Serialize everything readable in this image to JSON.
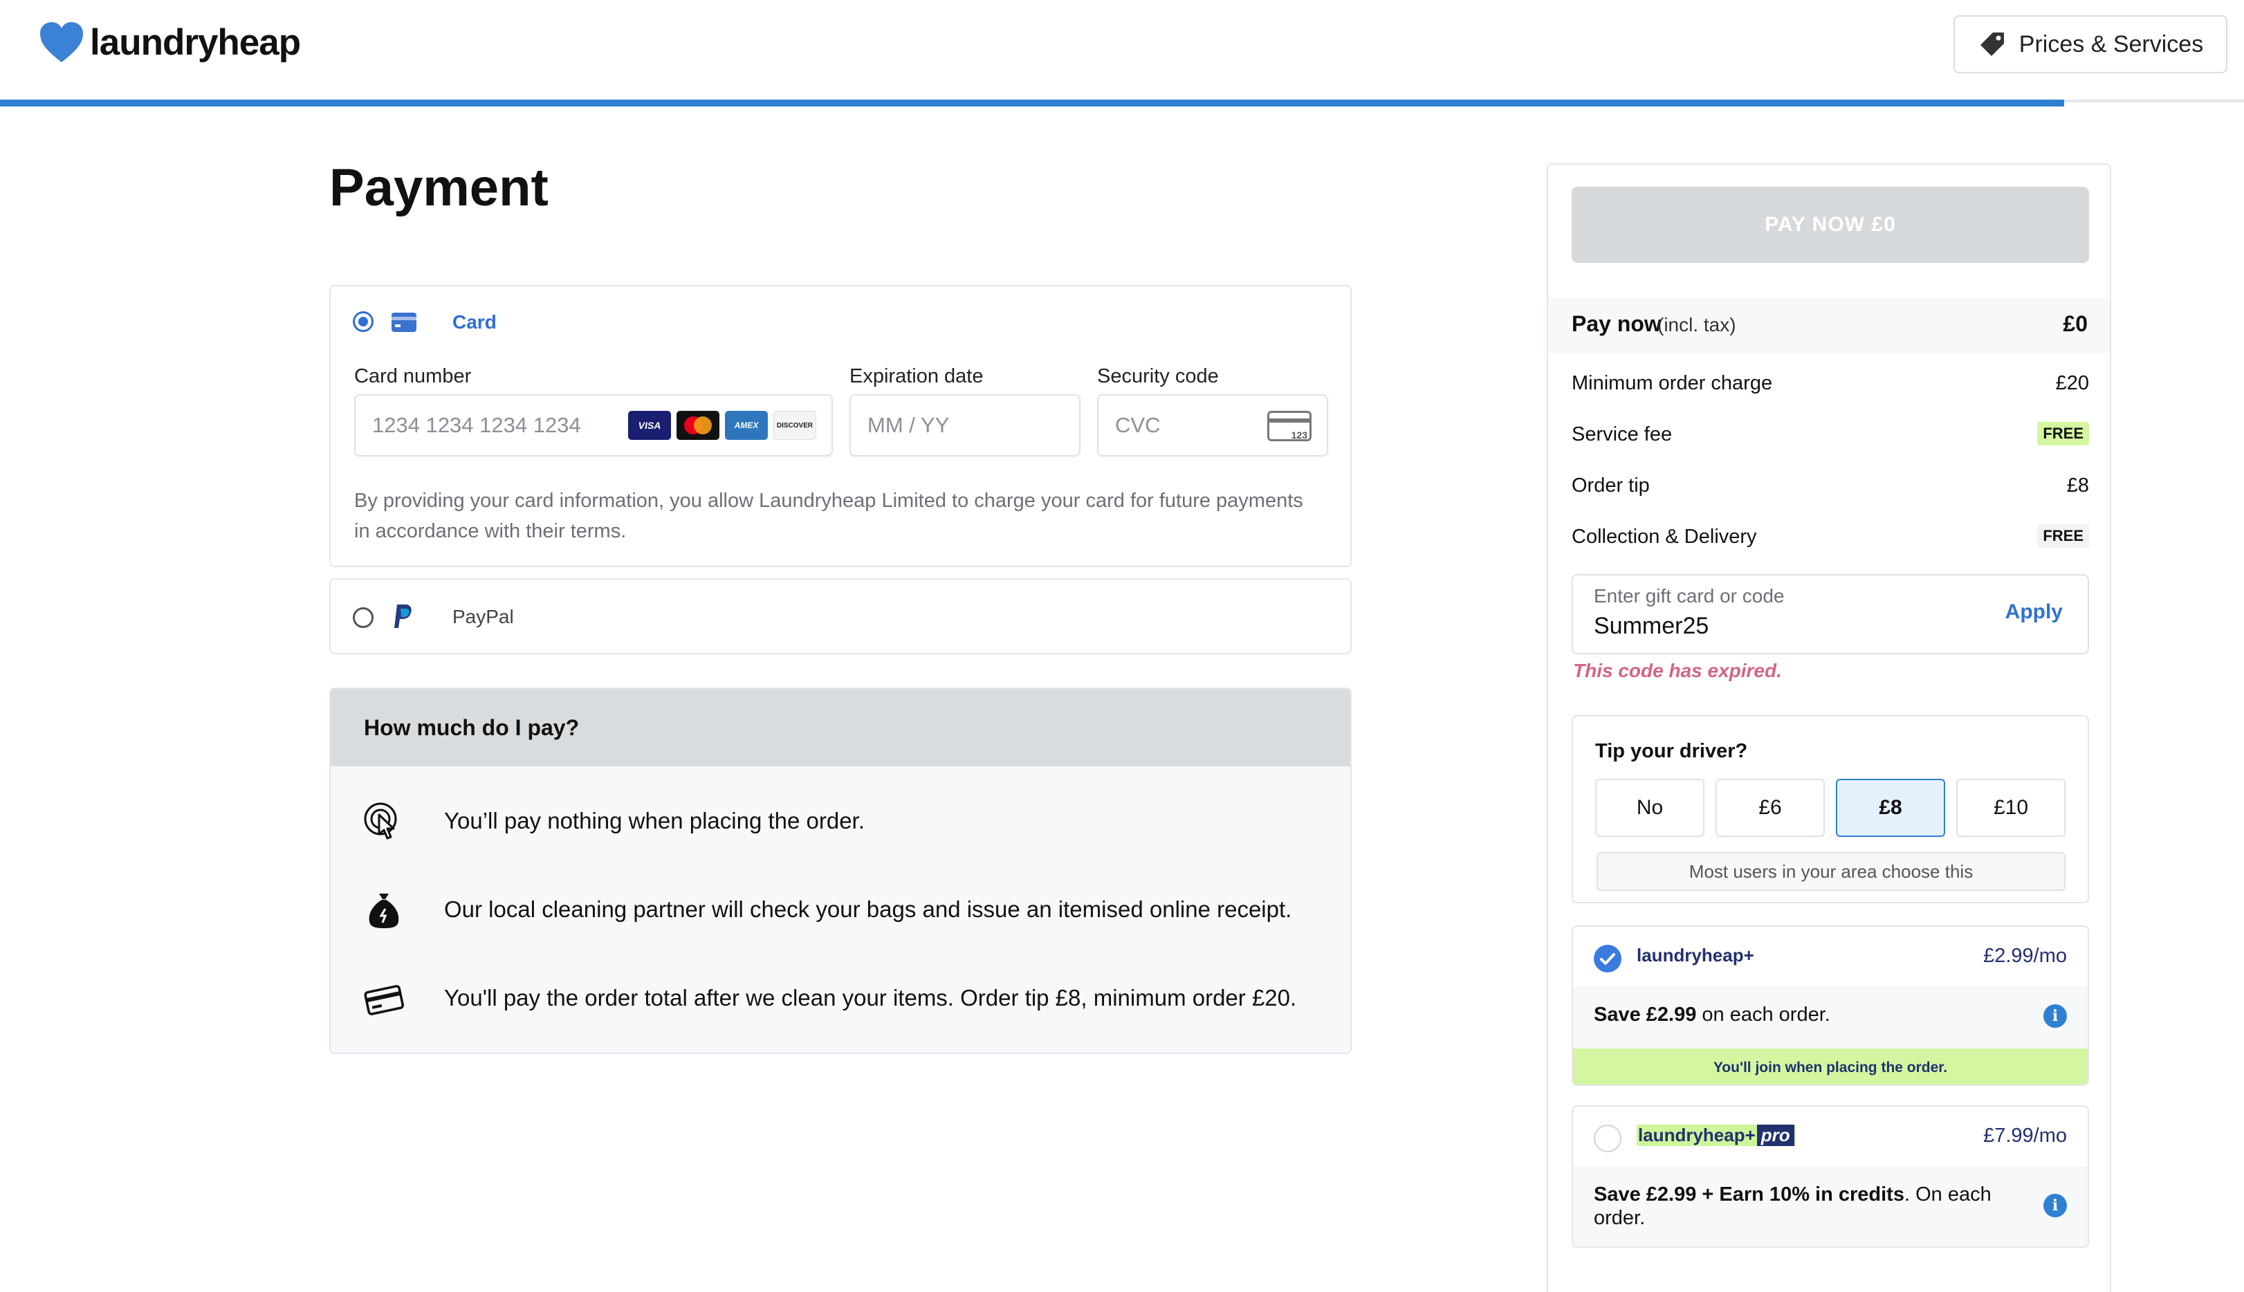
{
  "header": {
    "brand": "laundryheap",
    "prices_button": "Prices & Services",
    "progress_percent": 92,
    "colors": {
      "brand_blue": "#2f80d1",
      "navy": "#23306e",
      "green": "#d4f6a0"
    }
  },
  "page": {
    "title": "Payment"
  },
  "payment_methods": {
    "card": {
      "label": "Card",
      "selected": true,
      "card_number_label": "Card number",
      "card_number_placeholder": "1234 1234 1234 1234",
      "expiry_label": "Expiration date",
      "expiry_placeholder": "MM / YY",
      "cvc_label": "Security code",
      "cvc_placeholder": "CVC",
      "cvc_icon_text": "123",
      "card_brands": [
        "VISA",
        "mastercard",
        "AMEX",
        "DISCOVER"
      ],
      "consent": "By providing your card information, you allow Laundryheap Limited to charge your card for future payments in accordance with their terms."
    },
    "paypal": {
      "label": "PayPal",
      "selected": false
    }
  },
  "how_much": {
    "title": "How much do I pay?",
    "items": [
      {
        "icon": "tap-pointer-icon",
        "text": "You’ll pay nothing when placing the order."
      },
      {
        "icon": "money-bag-icon",
        "text": "Our local cleaning partner will check your bags and issue an itemised online receipt."
      },
      {
        "icon": "credit-card-icon",
        "text": "You'll pay the order total after we clean your items. Order tip £8, minimum order £20."
      }
    ]
  },
  "summary": {
    "pay_button": "PAY NOW £0",
    "pay_now_label": "Pay now",
    "pay_now_sub": "(incl. tax)",
    "pay_now_value": "£0",
    "rows": [
      {
        "label": "Minimum order charge",
        "value": "£20"
      },
      {
        "label": "Service fee",
        "value": "FREE"
      },
      {
        "label": "Order tip",
        "value": "£8"
      },
      {
        "label": "Collection & Delivery",
        "value": "FREE"
      }
    ],
    "gift": {
      "placeholder": "Enter gift card or code",
      "value": "Summer25",
      "apply": "Apply",
      "error": "This code has expired."
    }
  },
  "tip": {
    "title": "Tip your driver?",
    "options": [
      "No",
      "£6",
      "£8",
      "£10"
    ],
    "selected": "£8",
    "hint": "Most users in your area choose this"
  },
  "memberships": [
    {
      "name": "laundryheap+",
      "price": "£2.99/mo",
      "selected": true,
      "save_bold": "Save £2.99",
      "save_rest": " on each order.",
      "join_note": "You'll join when placing the order."
    },
    {
      "name": "laundryheap+",
      "pro_tag": "pro",
      "price": "£7.99/mo",
      "selected": false,
      "save_bold": "Save £2.99 + Earn 10% in credits",
      "save_rest": ". On each order."
    }
  ]
}
